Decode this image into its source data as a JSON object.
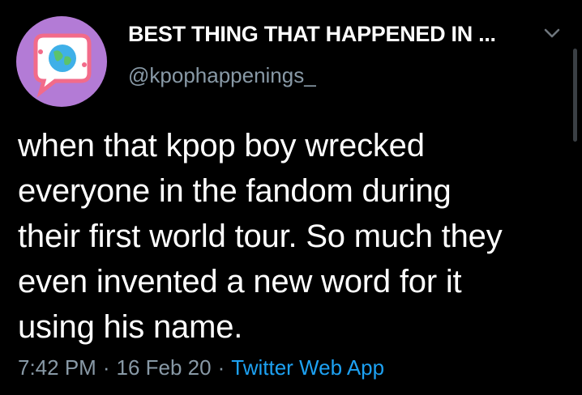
{
  "author": {
    "display_name": "BEST THING THAT HAPPENED IN ...",
    "handle": "@kpophappenings_",
    "avatar_icon": "globe-phone-logo"
  },
  "menu": {
    "icon": "chevron-down-icon"
  },
  "tweet": {
    "lines": [
      "when that kpop boy wrecked",
      "everyone in the fandom during",
      "their first world tour. So much they",
      "even invented a new word for it",
      "using his name."
    ]
  },
  "meta": {
    "time": "7:42 PM",
    "separator": "·",
    "date": "16 Feb 20",
    "source": "Twitter Web App"
  },
  "colors": {
    "background": "#000000",
    "text": "#ffffff",
    "secondary": "#8899a6",
    "link": "#1da1f2",
    "avatar_bg": "#b37bd6"
  }
}
